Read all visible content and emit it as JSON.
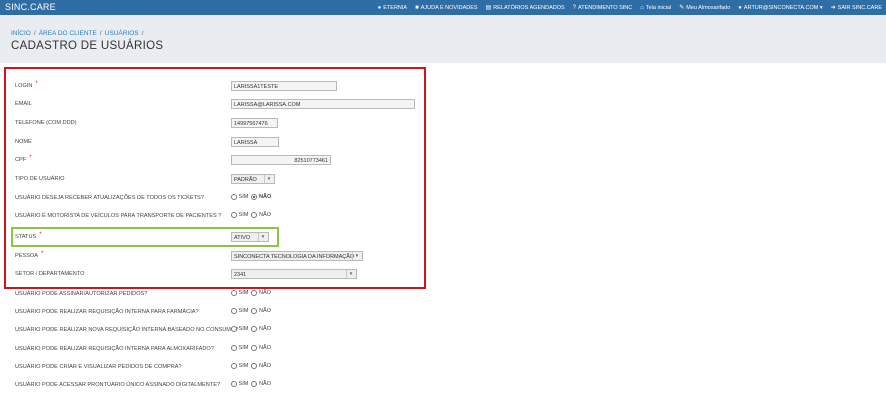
{
  "brand": "SINC.CARE",
  "nav": [
    {
      "icon": "chat-icon",
      "glyph": "●",
      "label": "ETERNIA"
    },
    {
      "icon": "book-icon",
      "glyph": "■",
      "label": "AJUDA E NOVIDADES"
    },
    {
      "icon": "report-icon",
      "glyph": "▤",
      "label": "RELATÓRIOS AGENDADOS"
    },
    {
      "icon": "support-icon",
      "glyph": "?",
      "label": "ATENDIMENTO SINC"
    },
    {
      "icon": "home-icon",
      "glyph": "⌂",
      "label": "Tela inicial"
    },
    {
      "icon": "edit-icon",
      "glyph": "✎",
      "label": "Meu Almoxarifado"
    },
    {
      "icon": "user-icon",
      "glyph": "●",
      "label": "ARTUR@SINCONECTA.COM ▾"
    },
    {
      "icon": "logout-icon",
      "glyph": "➜",
      "label": "SAIR SINC.CARE"
    }
  ],
  "breadcrumb": [
    "INÍCIO",
    "ÁREA DO CLIENTE",
    "USUÁRIOS"
  ],
  "breadcrumb_sep": "/",
  "page_title": "CADASTRO DE USUÁRIOS",
  "required_mark": "*",
  "radio_options": {
    "yes": "SIM",
    "no": "NÃO"
  },
  "form": {
    "login": {
      "label": "LOGIN",
      "value": "LARISSA1TESTE"
    },
    "email": {
      "label": "EMAIL",
      "value": "LARISSA@LARISSA.COM"
    },
    "phone": {
      "label": "TELEFONE (COM DDD)",
      "value": "14997567476"
    },
    "name": {
      "label": "NOME",
      "value": "LARISSA"
    },
    "cpf": {
      "label": "CPF",
      "value": "82510773461"
    },
    "user_type": {
      "label": "TIPO DE USUÁRIO",
      "value": "PADRÃO"
    },
    "ticket_updates": {
      "label": "USUÁRIO DESEJA RECEBER ATUALIZAÇÕES DE TODOS OS TICKETS?",
      "selected": "no"
    },
    "driver": {
      "label": "USUÁRIO É MOTORISTA DE VEÍCULOS PARA TRANSPORTE DE PACIENTES ?",
      "selected": "none"
    },
    "status": {
      "label": "STATUS",
      "value": "ATIVO"
    },
    "person": {
      "label": "PESSOA",
      "value": "SINCONECTA TECNOLOGIA DA INFORMAÇÃO"
    },
    "department": {
      "label": "SETOR / DEPARTAMENTO",
      "value": "2341"
    },
    "sign_orders": {
      "label": "USUÁRIO PODE ASSINAR/AUTORIZAR PEDIDOS?"
    },
    "pharmacy_req": {
      "label": "USUÁRIO PODE REALIZAR REQUISIÇÃO INTERNA PARA FARMÁCIA?"
    },
    "consumption_req": {
      "label": "USUÁRIO PODE REALIZAR NOVA REQUISIÇÃO INTERNA BASEADO NO CONSUMO?"
    },
    "warehouse_req": {
      "label": "USUÁRIO PODE REALIZAR REQUISIÇÃO INTERNA PARA ALMOXARIFADO?"
    },
    "purchase_orders": {
      "label": "USUÁRIO PODE CRIAR E VISUALIZAR PEDIDOS DE COMPRA?"
    },
    "digital_record": {
      "label": "USUÁRIO PODE ACESSAR PRONTUÁRIO ÚNICO ASSINADO DIGITALMENTE?"
    }
  },
  "colors": {
    "topbar": "#2f6ea4",
    "highlight_red": "#d0161b",
    "highlight_green": "#8cc63f",
    "link": "#2f7cc0"
  }
}
